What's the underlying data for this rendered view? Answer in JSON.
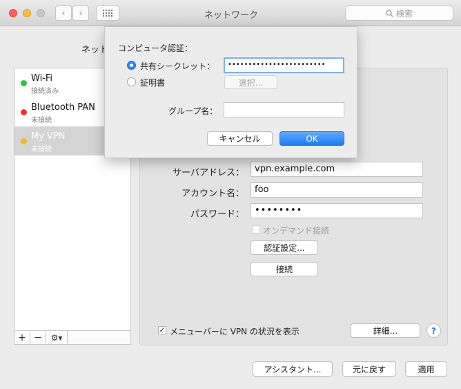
{
  "window": {
    "title": "ネットワーク",
    "search_placeholder": "検索",
    "location_label_partial": "ネット"
  },
  "traffic_lights": {
    "close": "#fc605c",
    "minimize": "#fdbc40",
    "zoom": "#c7c7c7"
  },
  "services": [
    {
      "name": "Wi-Fi",
      "status": "接続済み",
      "color": "#2dc43f"
    },
    {
      "name": "Bluetooth PAN",
      "status": "未接続",
      "color": "#f03232"
    },
    {
      "name": "My VPN",
      "status": "未接続",
      "color": "#f5b628",
      "selected": true
    }
  ],
  "sidebar_buttons": {
    "add": "+",
    "remove": "−",
    "gear": "⚙▾"
  },
  "vpn": {
    "server_label": "サーバアドレス：",
    "server_value": "vpn.example.com",
    "account_label": "アカウント名：",
    "account_value": "foo",
    "password_label": "パスワード：",
    "password_value": "••••••••",
    "on_demand_label": "オンデマンド接続",
    "auth_settings_button": "認証設定...",
    "connect_button": "接続"
  },
  "menubar_checkbox_label": "メニューバーに VPN の状況を表示",
  "advanced_button": "詳細...",
  "help_button": "?",
  "footer": {
    "assistant_button": "アシスタント...",
    "revert_button": "元に戻す",
    "apply_button": "適用"
  },
  "sheet": {
    "heading": "コンピュータ認証：",
    "shared_secret_label": "共有シークレット：",
    "shared_secret_value": "••••••••••••••••••••••••",
    "certificate_label": "証明書",
    "select_button": "選択...",
    "group_label": "グループ名：",
    "group_value": "",
    "cancel_button": "キャンセル",
    "ok_button": "OK"
  }
}
